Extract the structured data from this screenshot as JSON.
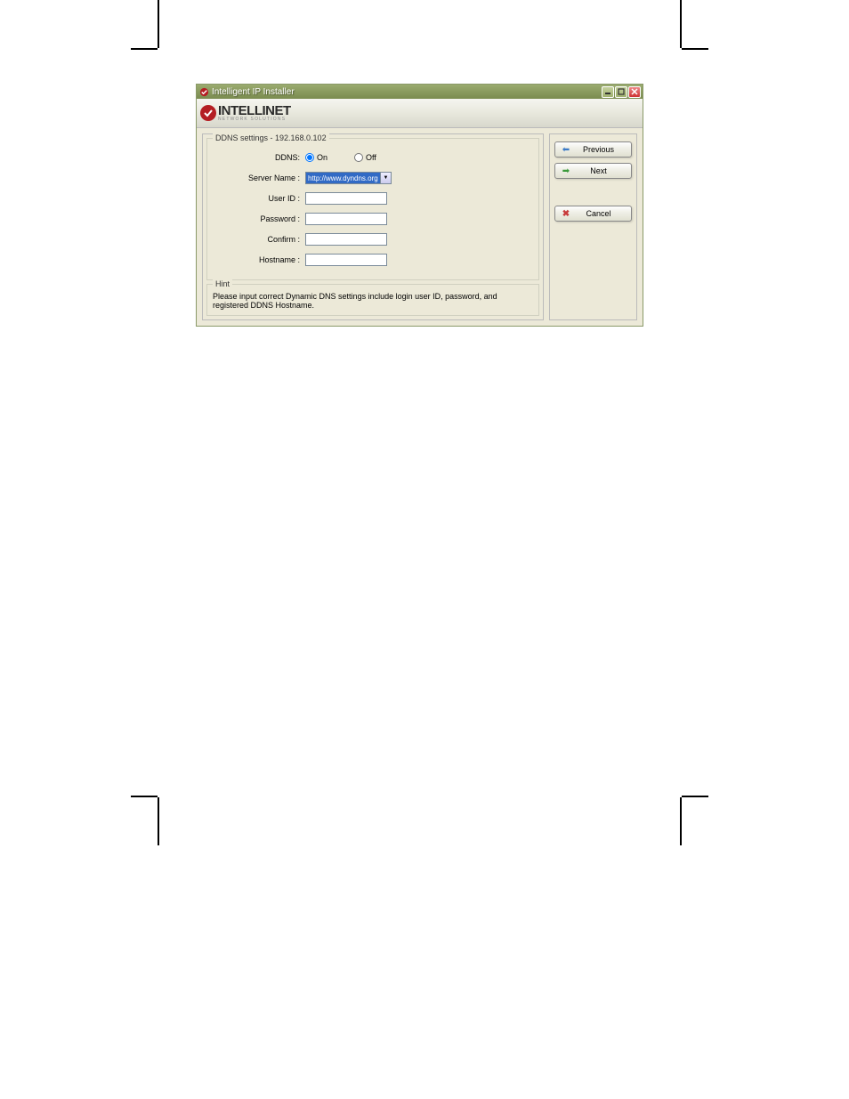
{
  "window": {
    "title": "Intelligent IP Installer"
  },
  "brand": {
    "name": "INTELLINET",
    "tagline": "NETWORK SOLUTIONS"
  },
  "groupbox": {
    "title": "DDNS settings - 192.168.0.102"
  },
  "form": {
    "ddns_label": "DDNS:",
    "on_label": "On",
    "off_label": "Off",
    "server_name_label": "Server Name :",
    "server_name_value": "http://www.dyndns.org",
    "user_id_label": "User ID :",
    "user_id_value": "",
    "password_label": "Password :",
    "password_value": "",
    "confirm_label": "Confirm :",
    "confirm_value": "",
    "hostname_label": "Hostname :",
    "hostname_value": ""
  },
  "hint": {
    "title": "Hint",
    "text": "Please input correct Dynamic DNS settings include login user ID, password, and registered DDNS Hostname."
  },
  "buttons": {
    "previous": "Previous",
    "next": "Next",
    "cancel": "Cancel"
  }
}
